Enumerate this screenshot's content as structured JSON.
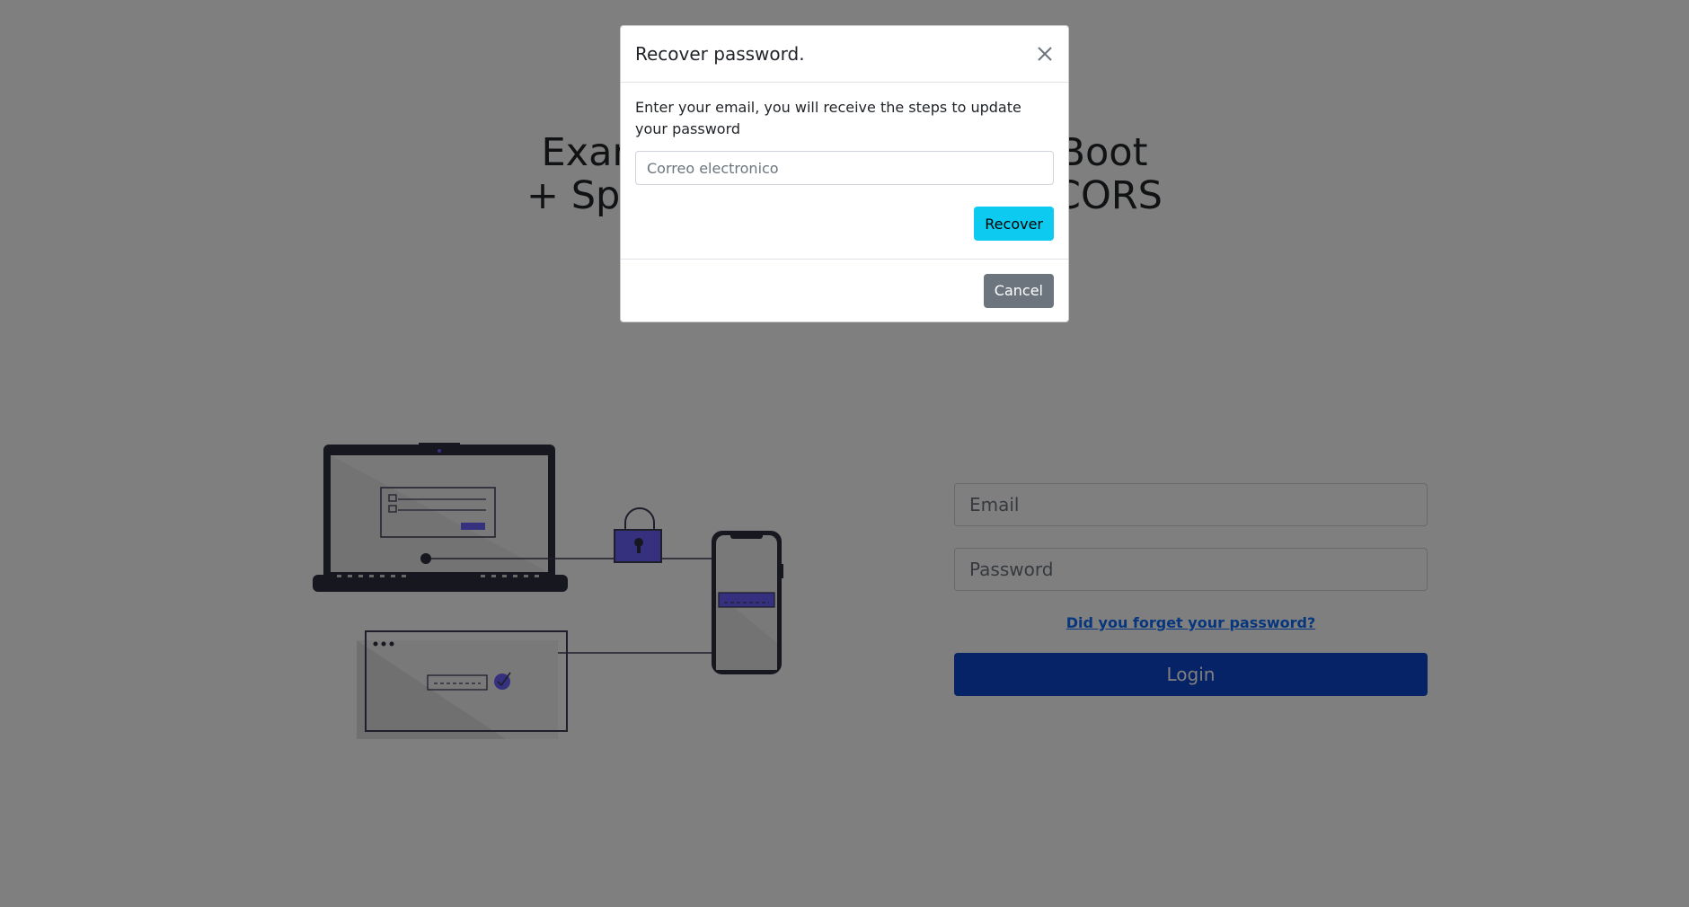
{
  "page": {
    "title_line1": "Example login with Spring Boot",
    "title_line2": "+ Spring Security + JWT + CORS"
  },
  "login": {
    "email_placeholder": "Email",
    "password_placeholder": "Password",
    "forgot_link": "Did you forget your password?",
    "login_label": "Login"
  },
  "modal": {
    "title": "Recover password.",
    "text": "Enter your email, you will receive the steps to update your password",
    "email_placeholder": "Correo electronico",
    "recover_label": "Recover",
    "cancel_label": "Cancel"
  },
  "icons": {
    "close": "close-icon",
    "lock": "lock-icon",
    "laptop": "laptop-icon",
    "phone": "phone-icon",
    "browser": "browser-window-icon"
  },
  "colors": {
    "primary": "#0d47cf",
    "info": "#0dcaf0",
    "secondary": "#6c757d",
    "illustration_accent": "#6c63ff"
  }
}
